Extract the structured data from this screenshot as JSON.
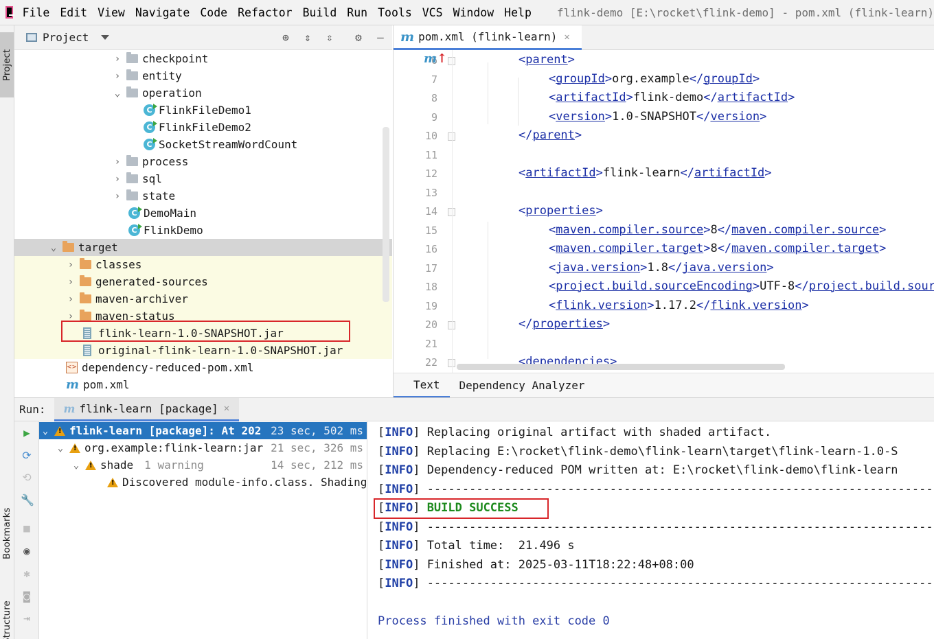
{
  "menu": {
    "items": [
      "File",
      "Edit",
      "View",
      "Navigate",
      "Code",
      "Refactor",
      "Build",
      "Run",
      "Tools",
      "VCS",
      "Window",
      "Help"
    ],
    "window_title": "flink-demo [E:\\rocket\\flink-demo] - pom.xml (flink-learn)"
  },
  "side_tabs": {
    "project": "Project",
    "bookmarks": "Bookmarks",
    "structure": "Structure"
  },
  "project_panel": {
    "title": "Project",
    "tree": [
      {
        "label": "checkpoint",
        "type": "folder",
        "depth": 3,
        "expanded": false
      },
      {
        "label": "entity",
        "type": "folder",
        "depth": 3,
        "expanded": false
      },
      {
        "label": "operation",
        "type": "folder",
        "depth": 3,
        "expanded": true
      },
      {
        "label": "FlinkFileDemo1",
        "type": "runclass",
        "depth": 4
      },
      {
        "label": "FlinkFileDemo2",
        "type": "runclass",
        "depth": 4
      },
      {
        "label": "SocketStreamWordCount",
        "type": "runclass",
        "depth": 4
      },
      {
        "label": "process",
        "type": "folder",
        "depth": 3,
        "expanded": false
      },
      {
        "label": "sql",
        "type": "folder",
        "depth": 3,
        "expanded": false
      },
      {
        "label": "state",
        "type": "folder",
        "depth": 3,
        "expanded": false
      },
      {
        "label": "DemoMain",
        "type": "class",
        "depth": 3
      },
      {
        "label": "FlinkDemo",
        "type": "class",
        "depth": 3
      },
      {
        "label": "target",
        "type": "orangefolder",
        "depth": 1,
        "expanded": true,
        "selected": true
      },
      {
        "label": "classes",
        "type": "orangefolder",
        "depth": 2,
        "expanded": false,
        "excluded": true
      },
      {
        "label": "generated-sources",
        "type": "orangefolder",
        "depth": 2,
        "expanded": false,
        "excluded": true
      },
      {
        "label": "maven-archiver",
        "type": "orangefolder",
        "depth": 2,
        "expanded": false,
        "excluded": true
      },
      {
        "label": "maven-status",
        "type": "orangefolder",
        "depth": 2,
        "expanded": false,
        "excluded": true
      },
      {
        "label": "flink-learn-1.0-SNAPSHOT.jar",
        "type": "jar",
        "depth": 2,
        "excluded": true
      },
      {
        "label": "original-flink-learn-1.0-SNAPSHOT.jar",
        "type": "jar",
        "depth": 2,
        "excluded": true
      },
      {
        "label": "dependency-reduced-pom.xml",
        "type": "xml",
        "depth": 1
      },
      {
        "label": "pom.xml",
        "type": "maven",
        "depth": 1
      }
    ]
  },
  "editor": {
    "tab_label": "pom.xml (flink-learn)",
    "lines": [
      {
        "n": "6",
        "indent": 1,
        "parts": [
          [
            "t",
            "<"
          ],
          [
            "n",
            "parent"
          ],
          [
            "t",
            ">"
          ]
        ]
      },
      {
        "n": "7",
        "indent": 2,
        "parts": [
          [
            "t",
            "<"
          ],
          [
            "n",
            "groupId"
          ],
          [
            "t",
            ">"
          ],
          [
            "x",
            "org.example"
          ],
          [
            "t",
            "</"
          ],
          [
            "n",
            "groupId"
          ],
          [
            "t",
            ">"
          ]
        ]
      },
      {
        "n": "8",
        "indent": 2,
        "parts": [
          [
            "t",
            "<"
          ],
          [
            "n",
            "artifactId"
          ],
          [
            "t",
            ">"
          ],
          [
            "x",
            "flink-demo"
          ],
          [
            "t",
            "</"
          ],
          [
            "n",
            "artifactId"
          ],
          [
            "t",
            ">"
          ]
        ]
      },
      {
        "n": "9",
        "indent": 2,
        "parts": [
          [
            "t",
            "<"
          ],
          [
            "n",
            "version"
          ],
          [
            "t",
            ">"
          ],
          [
            "x",
            "1.0-SNAPSHOT"
          ],
          [
            "t",
            "</"
          ],
          [
            "n",
            "version"
          ],
          [
            "t",
            ">"
          ]
        ]
      },
      {
        "n": "10",
        "indent": 1,
        "parts": [
          [
            "t",
            "</"
          ],
          [
            "n",
            "parent"
          ],
          [
            "t",
            ">"
          ]
        ]
      },
      {
        "n": "11",
        "indent": 0,
        "parts": []
      },
      {
        "n": "12",
        "indent": 1,
        "parts": [
          [
            "t",
            "<"
          ],
          [
            "n",
            "artifactId"
          ],
          [
            "t",
            ">"
          ],
          [
            "x",
            "flink-learn"
          ],
          [
            "t",
            "</"
          ],
          [
            "n",
            "artifactId"
          ],
          [
            "t",
            ">"
          ]
        ]
      },
      {
        "n": "13",
        "indent": 0,
        "parts": []
      },
      {
        "n": "14",
        "indent": 1,
        "parts": [
          [
            "t",
            "<"
          ],
          [
            "n",
            "properties"
          ],
          [
            "t",
            ">"
          ]
        ]
      },
      {
        "n": "15",
        "indent": 2,
        "parts": [
          [
            "t",
            "<"
          ],
          [
            "n",
            "maven.compiler.source"
          ],
          [
            "t",
            ">"
          ],
          [
            "x",
            "8"
          ],
          [
            "t",
            "</"
          ],
          [
            "n",
            "maven.compiler.source"
          ],
          [
            "t",
            ">"
          ]
        ]
      },
      {
        "n": "16",
        "indent": 2,
        "parts": [
          [
            "t",
            "<"
          ],
          [
            "n",
            "maven.compiler.target"
          ],
          [
            "t",
            ">"
          ],
          [
            "x",
            "8"
          ],
          [
            "t",
            "</"
          ],
          [
            "n",
            "maven.compiler.target"
          ],
          [
            "t",
            ">"
          ]
        ]
      },
      {
        "n": "17",
        "indent": 2,
        "parts": [
          [
            "t",
            "<"
          ],
          [
            "n",
            "java.version"
          ],
          [
            "t",
            ">"
          ],
          [
            "x",
            "1.8"
          ],
          [
            "t",
            "</"
          ],
          [
            "n",
            "java.version"
          ],
          [
            "t",
            ">"
          ]
        ]
      },
      {
        "n": "18",
        "indent": 2,
        "parts": [
          [
            "t",
            "<"
          ],
          [
            "n",
            "project.build.sourceEncoding"
          ],
          [
            "t",
            ">"
          ],
          [
            "x",
            "UTF-8"
          ],
          [
            "t",
            "</"
          ],
          [
            "n",
            "project.build.sourceEncoding"
          ],
          [
            "t",
            ">"
          ]
        ]
      },
      {
        "n": "19",
        "indent": 2,
        "parts": [
          [
            "t",
            "<"
          ],
          [
            "n",
            "flink.version"
          ],
          [
            "t",
            ">"
          ],
          [
            "x",
            "1.17.2"
          ],
          [
            "t",
            "</"
          ],
          [
            "n",
            "flink.version"
          ],
          [
            "t",
            ">"
          ]
        ]
      },
      {
        "n": "20",
        "indent": 1,
        "parts": [
          [
            "t",
            "</"
          ],
          [
            "n",
            "properties"
          ],
          [
            "t",
            ">"
          ]
        ]
      },
      {
        "n": "21",
        "indent": 0,
        "parts": []
      },
      {
        "n": "22",
        "indent": 1,
        "parts": [
          [
            "t",
            "<"
          ],
          [
            "n",
            "dependencies"
          ],
          [
            "t",
            ">"
          ]
        ]
      }
    ],
    "bottom_tabs": [
      "Text",
      "Dependency Analyzer"
    ]
  },
  "run_panel": {
    "label": "Run:",
    "tab_label": "flink-learn [package]",
    "tree": [
      {
        "label": "flink-learn [package]: At 202",
        "time": "23 sec, 502 ms",
        "depth": 0,
        "selected": true
      },
      {
        "label": "org.example:flink-learn:jar",
        "time": "21 sec, 326 ms",
        "depth": 1
      },
      {
        "label": "shade",
        "note": "1 warning",
        "time": "14 sec, 212 ms",
        "depth": 2
      },
      {
        "label": "Discovered module-info.class. Shading",
        "time": "",
        "depth": 3
      }
    ],
    "console": [
      {
        "tag": "INFO",
        "text": "Replacing original artifact with shaded artifact."
      },
      {
        "tag": "INFO",
        "text": "Replacing E:\\rocket\\flink-demo\\flink-learn\\target\\flink-learn-1.0-S"
      },
      {
        "tag": "INFO",
        "text": "Dependency-reduced POM written at: E:\\rocket\\flink-demo\\flink-learn"
      },
      {
        "tag": "INFO",
        "text": "------------------------------------------------------------------------"
      },
      {
        "tag": "INFO",
        "text": "BUILD SUCCESS",
        "success": true
      },
      {
        "tag": "INFO",
        "text": "------------------------------------------------------------------------"
      },
      {
        "tag": "INFO",
        "text": "Total time:  21.496 s"
      },
      {
        "tag": "INFO",
        "text": "Finished at: 2025-03-11T18:22:48+08:00"
      },
      {
        "tag": "INFO",
        "text": "------------------------------------------------------------------------"
      }
    ],
    "exit_message": "Process finished with exit code 0"
  }
}
